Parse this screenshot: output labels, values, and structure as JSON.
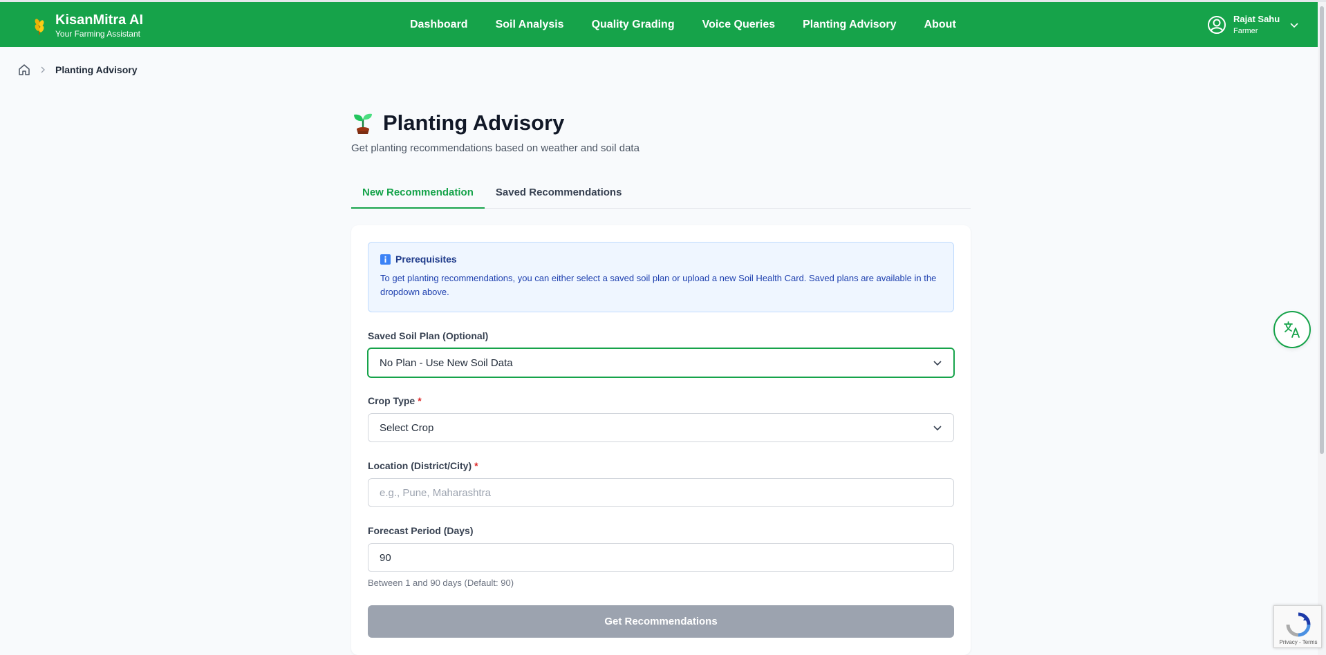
{
  "app": {
    "name": "KisanMitra AI",
    "tagline": "Your Farming Assistant"
  },
  "nav": {
    "items": [
      {
        "label": "Dashboard"
      },
      {
        "label": "Soil Analysis"
      },
      {
        "label": "Quality Grading"
      },
      {
        "label": "Voice Queries"
      },
      {
        "label": "Planting Advisory"
      },
      {
        "label": "About"
      }
    ]
  },
  "user": {
    "name": "Rajat Sahu",
    "role": "Farmer"
  },
  "breadcrumb": {
    "current": "Planting Advisory"
  },
  "page": {
    "title": "Planting Advisory",
    "subtitle": "Get planting recommendations based on weather and soil data"
  },
  "tabs": [
    {
      "label": "New Recommendation",
      "active": true
    },
    {
      "label": "Saved Recommendations",
      "active": false
    }
  ],
  "info": {
    "title": "Prerequisites",
    "text": "To get planting recommendations, you can either select a saved soil plan or upload a new Soil Health Card. Saved plans are available in the dropdown above."
  },
  "form": {
    "soil_plan": {
      "label": "Saved Soil Plan (Optional)",
      "value": "No Plan - Use New Soil Data"
    },
    "crop_type": {
      "label": "Crop Type",
      "required_mark": "*",
      "value": "Select Crop"
    },
    "location": {
      "label": "Location (District/City)",
      "required_mark": "*",
      "placeholder": "e.g., Pune, Maharashtra",
      "value": ""
    },
    "forecast": {
      "label": "Forecast Period (Days)",
      "value": "90",
      "hint": "Between 1 and 90 days (Default: 90)"
    },
    "submit_label": "Get Recommendations"
  },
  "recaptcha": {
    "links": "Privacy - Terms"
  },
  "colors": {
    "primary": "#16a34a",
    "info_bg": "#eff6ff",
    "disabled_button": "#9ca3af"
  }
}
